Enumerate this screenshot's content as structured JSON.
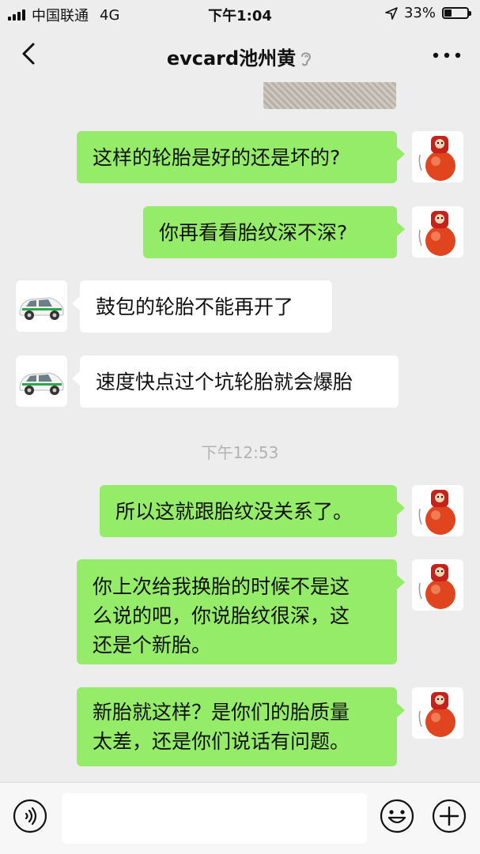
{
  "status_bar": {
    "carrier": "中国联通",
    "network": "4G",
    "time": "下午1:04",
    "battery": "33%",
    "battery_level": 0.33
  },
  "nav": {
    "title": "evcard池州黄",
    "back_icon": "chevron-left-icon",
    "more_icon": "ellipsis-icon"
  },
  "messages": [
    {
      "side": "out",
      "text": "这样的轮胎是好的还是坏的?"
    },
    {
      "side": "out",
      "text": "你再看看胎纹深不深?"
    },
    {
      "side": "in",
      "text": "鼓包的轮胎不能再开了"
    },
    {
      "side": "in",
      "text": "速度快点过个坑轮胎就会爆胎"
    },
    {
      "side": "out",
      "text": "所以这就跟胎纹没关系了。"
    },
    {
      "side": "out",
      "lines": [
        "你上次给我换胎的时候不是这",
        "么说的吧，你说胎纹很深，这",
        "还是个新胎。"
      ]
    },
    {
      "side": "out",
      "lines": [
        "新胎就这样？是你们的胎质量",
        "太差，还是你们说话有问题。"
      ]
    }
  ],
  "timestamp": "下午12:53",
  "input_bar": {
    "voice_icon": "voice-icon",
    "emoji_icon": "emoji-icon",
    "plus_icon": "plus-icon",
    "input_value": ""
  },
  "colors": {
    "outgoing_bubble": "#95ec69",
    "incoming_bubble": "#ffffff",
    "background": "#ededed"
  }
}
